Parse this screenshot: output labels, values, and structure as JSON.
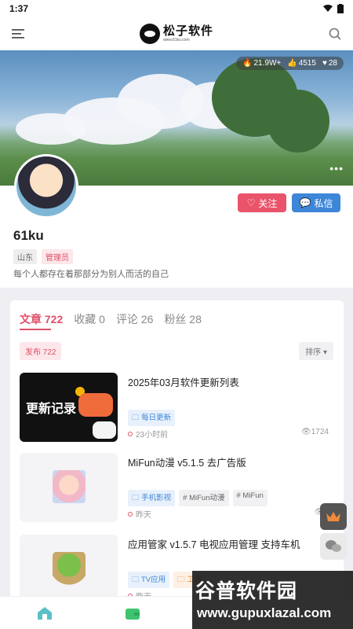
{
  "status_bar": {
    "time": "1:37"
  },
  "header": {
    "brand_name": "松子软件",
    "brand_url": "www.61ku.com"
  },
  "banner": {
    "stats": {
      "views": "21.9W+",
      "likes": "4515",
      "favorites": "28"
    }
  },
  "profile": {
    "follow_label": "关注",
    "message_label": "私信",
    "username": "61ku",
    "location_tag": "山东",
    "role_tag": "管理员",
    "bio": "每个人都存在着那部分为别人而活的自己"
  },
  "tabs": [
    {
      "label": "文章",
      "count": "722"
    },
    {
      "label": "收藏",
      "count": "0"
    },
    {
      "label": "评论",
      "count": "26"
    },
    {
      "label": "粉丝",
      "count": "28"
    }
  ],
  "filter": {
    "publish_label": "发布",
    "publish_count": "722",
    "sort_label": "排序"
  },
  "posts": [
    {
      "thumb_text": "更新记录",
      "title": "2025年03月软件更新列表",
      "category": "每日更新",
      "tags": [],
      "time": "23小时前",
      "views": "1724"
    },
    {
      "title": "MiFun动漫 v5.1.5 去广告版",
      "category": "手机影视",
      "tags": [
        "# MiFun动漫",
        "# MiFun"
      ],
      "time": "昨天",
      "views": "2"
    },
    {
      "title": "应用管家 v1.5.7 电视应用管理 支持车机",
      "category": "TV应用",
      "category2": "工具",
      "tags": [],
      "time": "昨天",
      "views": ""
    }
  ],
  "watermark": {
    "title": "谷普软件园",
    "url": "www.gupuxlazal.com"
  },
  "colors": {
    "accent": "#e0506a",
    "blue": "#3e86d8"
  }
}
